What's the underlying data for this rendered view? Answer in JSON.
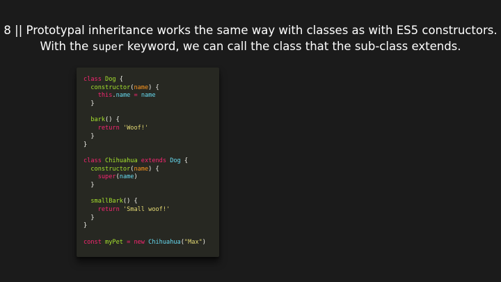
{
  "heading": {
    "line1": "8 || Prototypal inheritance works the same way with classes as with ES5 constructors.",
    "line2_pre": "With the ",
    "line2_kw": "super",
    "line2_post": " keyword, we can call the class that the sub-class extends."
  },
  "code": {
    "lines": [
      [
        {
          "t": "class ",
          "c": "pink"
        },
        {
          "t": "Dog",
          "c": "green"
        },
        {
          "t": " {",
          "c": "white"
        }
      ],
      [
        {
          "t": "  constructor",
          "c": "green"
        },
        {
          "t": "(",
          "c": "white"
        },
        {
          "t": "name",
          "c": "orange"
        },
        {
          "t": ") {",
          "c": "white"
        }
      ],
      [
        {
          "t": "    this",
          "c": "pink"
        },
        {
          "t": ".",
          "c": "white"
        },
        {
          "t": "name",
          "c": "cyan"
        },
        {
          "t": " = ",
          "c": "pink"
        },
        {
          "t": "name",
          "c": "cyan"
        }
      ],
      [
        {
          "t": "  }",
          "c": "white"
        }
      ],
      [
        {
          "t": "",
          "c": "white"
        }
      ],
      [
        {
          "t": "  bark",
          "c": "green"
        },
        {
          "t": "() {",
          "c": "white"
        }
      ],
      [
        {
          "t": "    return ",
          "c": "pink"
        },
        {
          "t": "'Woof!'",
          "c": "yellow"
        }
      ],
      [
        {
          "t": "  }",
          "c": "white"
        }
      ],
      [
        {
          "t": "}",
          "c": "white"
        }
      ],
      [
        {
          "t": "",
          "c": "white"
        }
      ],
      [
        {
          "t": "class ",
          "c": "pink"
        },
        {
          "t": "Chihuahua ",
          "c": "green"
        },
        {
          "t": "extends ",
          "c": "pink"
        },
        {
          "t": "Dog",
          "c": "cyan"
        },
        {
          "t": " {",
          "c": "white"
        }
      ],
      [
        {
          "t": "  constructor",
          "c": "green"
        },
        {
          "t": "(",
          "c": "white"
        },
        {
          "t": "name",
          "c": "orange"
        },
        {
          "t": ") {",
          "c": "white"
        }
      ],
      [
        {
          "t": "    super",
          "c": "pink"
        },
        {
          "t": "(",
          "c": "white"
        },
        {
          "t": "name",
          "c": "cyan"
        },
        {
          "t": ")",
          "c": "white"
        }
      ],
      [
        {
          "t": "  }",
          "c": "white"
        }
      ],
      [
        {
          "t": "",
          "c": "white"
        }
      ],
      [
        {
          "t": "  smallBark",
          "c": "green"
        },
        {
          "t": "() {",
          "c": "white"
        }
      ],
      [
        {
          "t": "    return ",
          "c": "pink"
        },
        {
          "t": "'Small woof!'",
          "c": "yellow"
        }
      ],
      [
        {
          "t": "  }",
          "c": "white"
        }
      ],
      [
        {
          "t": "}",
          "c": "white"
        }
      ],
      [
        {
          "t": "",
          "c": "white"
        }
      ],
      [
        {
          "t": "const ",
          "c": "pink"
        },
        {
          "t": "myPet",
          "c": "green"
        },
        {
          "t": " = ",
          "c": "pink"
        },
        {
          "t": "new ",
          "c": "pink"
        },
        {
          "t": "Chihuahua",
          "c": "cyan"
        },
        {
          "t": "(",
          "c": "white"
        },
        {
          "t": "\"Max\"",
          "c": "yellow"
        },
        {
          "t": ")",
          "c": "white"
        }
      ]
    ]
  },
  "colors": {
    "background": "#1b1b1b",
    "code_background": "#272822"
  }
}
